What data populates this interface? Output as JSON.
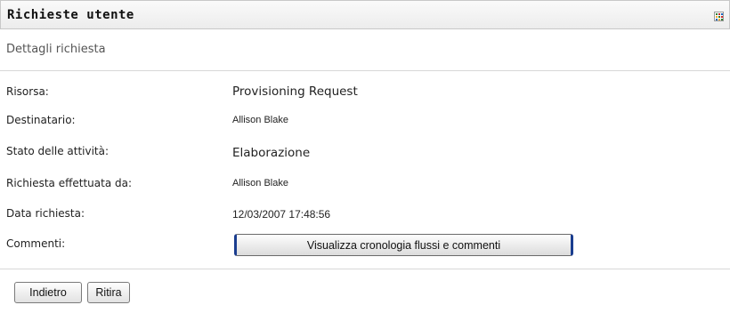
{
  "header": {
    "title": "Richieste utente",
    "menu_icon_colors": [
      "#2e7d32",
      "#c62828",
      "#1565c0",
      "#f9a825",
      "#2e7d32",
      "#c62828",
      "#1565c0",
      "#f9a825",
      "#2e7d32"
    ]
  },
  "section": {
    "subtitle": "Dettagli richiesta"
  },
  "details": {
    "resource_label": "Risorsa:",
    "resource_value": "Provisioning Request",
    "recipient_label": "Destinatario:",
    "recipient_value": "Allison Blake",
    "status_label": "Stato delle attività:",
    "status_value": "Elaborazione",
    "requested_by_label": "Richiesta effettuata da:",
    "requested_by_value": "Allison Blake",
    "date_label": "Data richiesta:",
    "date_value": "12/03/2007 17:48:56",
    "comments_label": "Commenti:",
    "history_button_label": "Visualizza cronologia flussi e commenti"
  },
  "footer": {
    "back_label": "Indietro",
    "withdraw_label": "Ritira"
  }
}
